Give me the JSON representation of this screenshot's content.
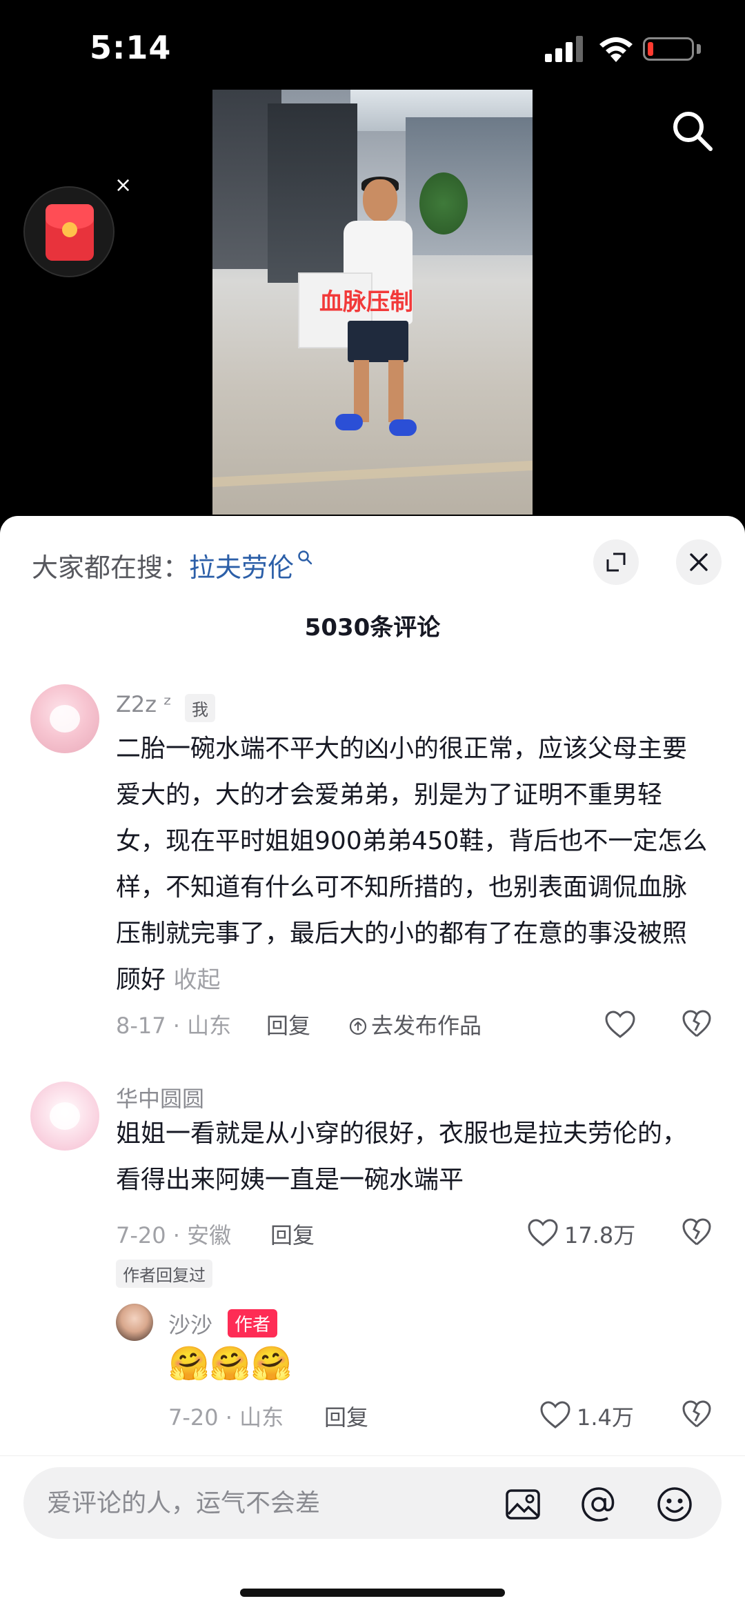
{
  "status_bar": {
    "time": "5:14"
  },
  "video": {
    "caption": "血脉压制"
  },
  "sheet": {
    "hot_search_prefix": "大家都在搜：",
    "hot_search_keyword": "拉夫劳伦",
    "comment_count_title": "5030条评论"
  },
  "comments": [
    {
      "username": "Z2z ᶻ",
      "tag": "我",
      "text": "二胎一碗水端不平大的凶小的很正常，应该父母主要爱大的，大的才会爱弟弟，别是为了证明不重男轻女，现在平时姐姐900弟弟450鞋，背后也不一定怎么样，不知道有什么可不知所措的，也别表面调侃血脉压制就完事了，最后大的小的都有了在意的事没被照顾好",
      "collapse": "收起",
      "date_location": "8-17 · 山东",
      "reply": "回复",
      "publish": "去发布作品"
    },
    {
      "username": "华中圆圆",
      "text": "姐姐一看就是从小穿的很好，衣服也是拉夫劳伦的，看得出来阿姨一直是一碗水端平",
      "date_location": "7-20 · 安徽",
      "reply": "回复",
      "likes": "17.8万",
      "author_replied": "作者回复过"
    },
    {
      "username": "沙沙",
      "tag": "作者",
      "text": "🤗🤗🤗",
      "date_location": "7-20 · 山东",
      "reply": "回复",
      "likes": "1.4万"
    }
  ],
  "input": {
    "placeholder": "爱评论的人，运气不会差"
  },
  "colors": {
    "accent": "#fe2c55",
    "link": "#2c5fa8",
    "caption": "#f23a3a"
  }
}
